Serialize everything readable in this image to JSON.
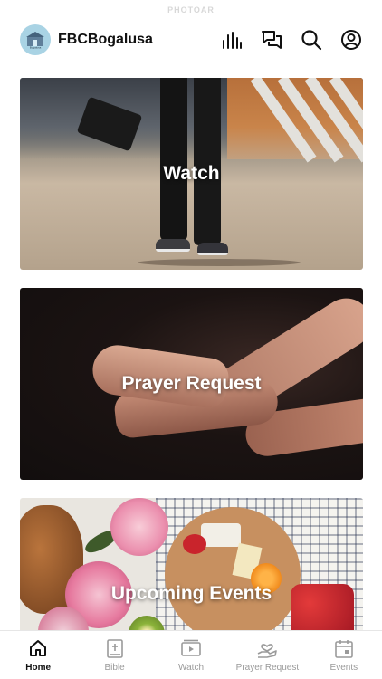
{
  "status": {
    "text": "PHOTOAR"
  },
  "header": {
    "org_name": "FBCBogalusa",
    "logo_text": "Bogalusa",
    "icons": [
      "chart-bars-icon",
      "chat-icon",
      "search-icon",
      "profile-icon"
    ]
  },
  "cards": [
    {
      "title": "Watch"
    },
    {
      "title": "Prayer Request"
    },
    {
      "title": "Upcoming Events"
    }
  ],
  "tabbar": {
    "items": [
      {
        "label": "Home",
        "icon": "home-icon",
        "active": true
      },
      {
        "label": "Bible",
        "icon": "bible-icon",
        "active": false
      },
      {
        "label": "Watch",
        "icon": "video-icon",
        "active": false
      },
      {
        "label": "Prayer Request",
        "icon": "prayer-hands-icon",
        "active": false
      },
      {
        "label": "Events",
        "icon": "calendar-icon",
        "active": false
      }
    ]
  },
  "colors": {
    "active": "#111111",
    "inactive": "#9a9a9a",
    "logo_bg": "#a9d3e4"
  }
}
